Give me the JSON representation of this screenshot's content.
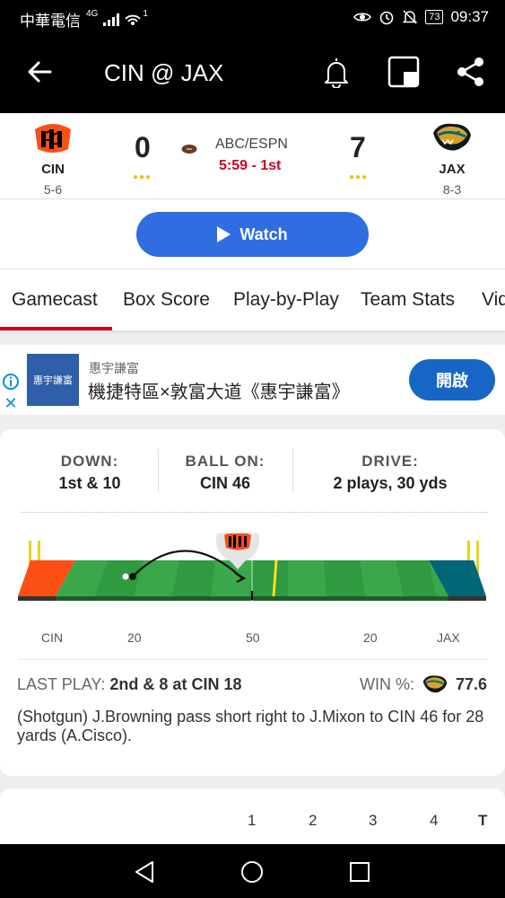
{
  "status_bar": {
    "carrier": "中華電信",
    "signal_label": "4G",
    "hotspot_badge": "1",
    "battery": "73",
    "time": "09:37"
  },
  "app_bar": {
    "title": "CIN @ JAX"
  },
  "game": {
    "away": {
      "abbr": "CIN",
      "record": "5-6",
      "score": "0",
      "color": "#FB4F14"
    },
    "home": {
      "abbr": "JAX",
      "record": "8-3",
      "score": "7",
      "color": "#006778"
    },
    "network": "ABC/ESPN",
    "clock": "5:59 - 1st",
    "timeout_dots": "●●●"
  },
  "watch": {
    "label": "Watch"
  },
  "tabs": [
    {
      "label": "Gamecast"
    },
    {
      "label": "Box Score"
    },
    {
      "label": "Play-by-Play"
    },
    {
      "label": "Team Stats"
    },
    {
      "label": "Vid"
    }
  ],
  "ad": {
    "logo_text": "惠宇謙富",
    "sponsor": "惠宇謙富",
    "headline": "機捷特區×敦富大道《惠宇謙富》",
    "cta": "開啟"
  },
  "situation": {
    "down_label": "DOWN:",
    "down_value": "1st & 10",
    "ball_on_label": "BALL ON:",
    "ball_on_value": "CIN 46",
    "drive_label": "DRIVE:",
    "drive_value": "2 plays, 30 yds"
  },
  "field": {
    "left_label": "CIN",
    "yard_20_left": "20",
    "yard_50": "50",
    "yard_20_right": "20",
    "right_label": "JAX"
  },
  "last_play": {
    "label": "LAST PLAY:",
    "situation": "2nd & 8 at CIN 18",
    "win_label": "WIN %:",
    "win_value": "77.6",
    "description": "(Shotgun) J.Browning pass short right to J.Mixon to CIN 46 for 28 yards (A.Cisco)."
  },
  "quarters": [
    "1",
    "2",
    "3",
    "4",
    "T"
  ]
}
